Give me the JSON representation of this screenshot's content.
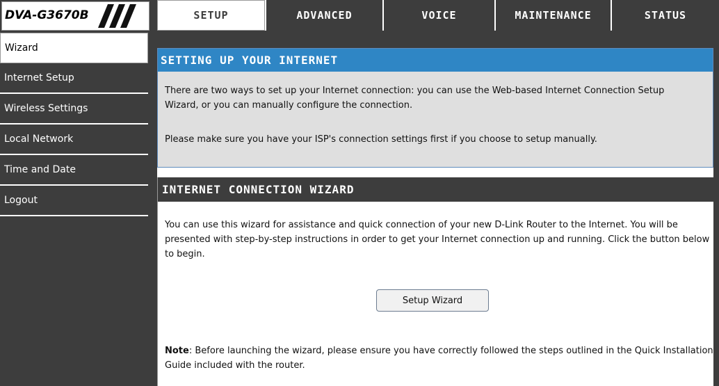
{
  "brand": {
    "model": "DVA-G3670B"
  },
  "tabs": [
    {
      "label": "SETUP",
      "active": true
    },
    {
      "label": "ADVANCED",
      "active": false
    },
    {
      "label": "VOICE",
      "active": false
    },
    {
      "label": "MAINTENANCE",
      "active": false
    },
    {
      "label": "STATUS",
      "active": false
    }
  ],
  "sidebar": {
    "items": [
      {
        "label": "Wizard",
        "active": true
      },
      {
        "label": "Internet Setup",
        "active": false
      },
      {
        "label": "Wireless Settings",
        "active": false
      },
      {
        "label": "Local Network",
        "active": false
      },
      {
        "label": "Time and Date",
        "active": false
      },
      {
        "label": "Logout",
        "active": false
      }
    ]
  },
  "setup_section": {
    "title": "SETTING UP YOUR INTERNET",
    "paragraph1": "There are two ways to set up your Internet connection: you can use the Web-based Internet Connection Setup Wizard, or you can manually configure the connection.",
    "paragraph2": "Please make sure you have your ISP's connection settings first if you choose to setup manually."
  },
  "wizard_section": {
    "title": "INTERNET CONNECTION WIZARD",
    "paragraph": "You can use this wizard for assistance and quick connection of your new D-Link Router to the Internet. You will be presented with step-by-step instructions in order to get your Internet connection up and running. Click the button below to begin.",
    "button_label": "Setup Wizard",
    "note_label": "Note",
    "note_text": ": Before launching the wizard, please ensure you have correctly followed the steps outlined in the Quick Installation Guide included with the router."
  },
  "colors": {
    "dark_bg": "#3d3d3d",
    "accent_blue": "#2f86c5",
    "panel_gray": "#dfdfdf"
  }
}
